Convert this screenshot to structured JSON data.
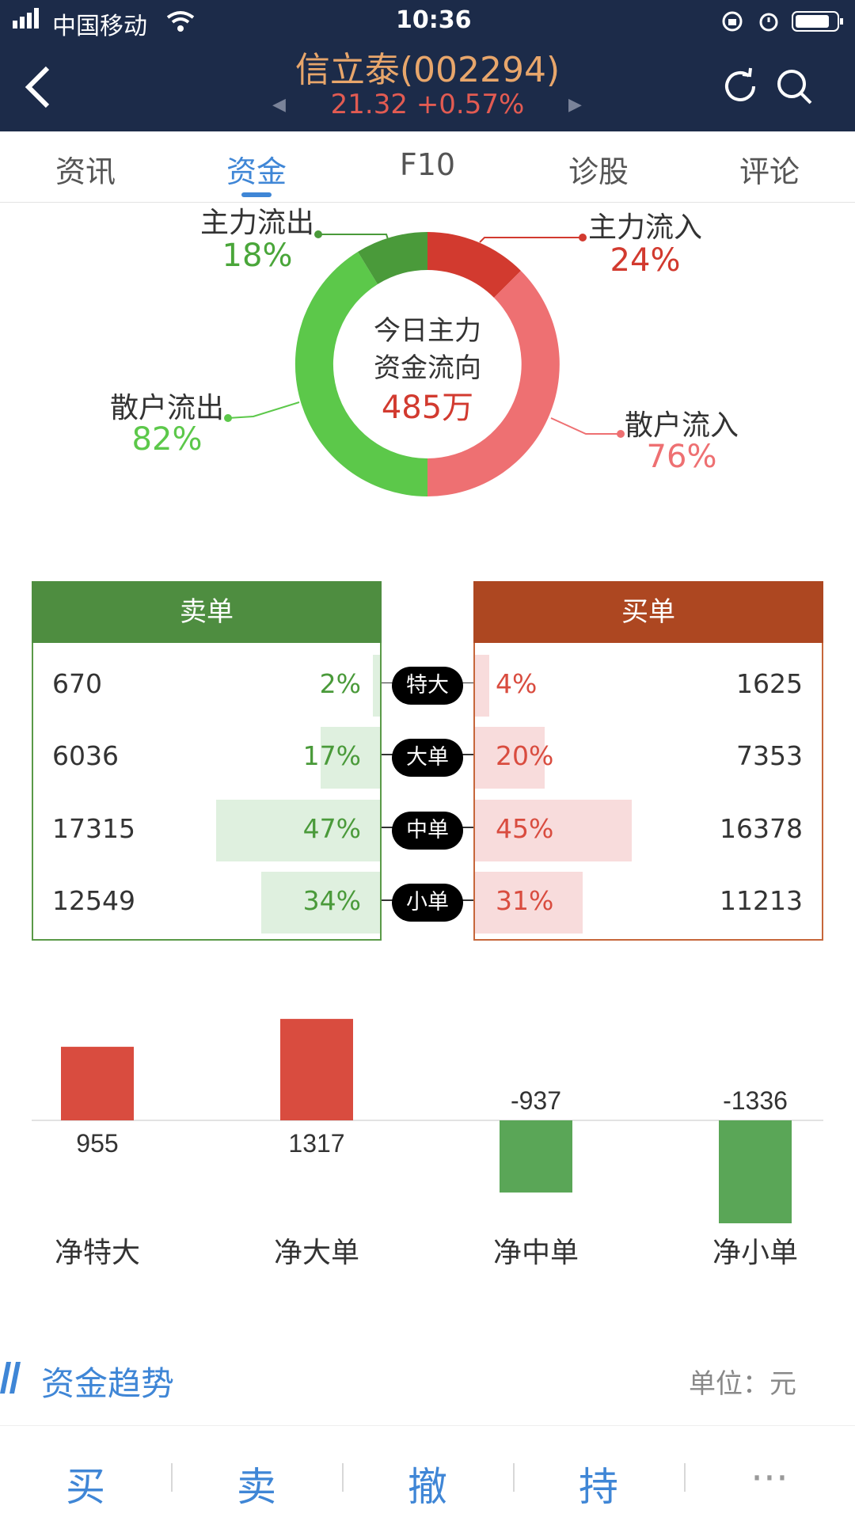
{
  "status_bar": {
    "carrier": "中国移动",
    "time": "10:36"
  },
  "header": {
    "title": "信立泰(002294)",
    "price": "21.32 +0.57%"
  },
  "tabs": [
    {
      "label": "资讯"
    },
    {
      "label": "资金",
      "active": true
    },
    {
      "label": "F10"
    },
    {
      "label": "诊股"
    },
    {
      "label": "评论"
    }
  ],
  "donut": {
    "center_line1": "今日主力",
    "center_line2": "资金流向",
    "center_value": "485万",
    "main_out": {
      "label": "主力流出",
      "pct": "18%"
    },
    "main_in": {
      "label": "主力流入",
      "pct": "24%"
    },
    "retail_out": {
      "label": "散户流出",
      "pct": "82%"
    },
    "retail_in": {
      "label": "散户流入",
      "pct": "76%"
    },
    "colors": {
      "main_in": "#d23a2f",
      "retail_in": "#ee7072",
      "main_out": "#4a9a3a",
      "retail_out": "#5cc84a"
    }
  },
  "orders": {
    "sell_header": "卖单",
    "buy_header": "买单",
    "rows": [
      {
        "type": "特大",
        "sell": "670",
        "sell_pct": "2%",
        "sell_frac": 0.02,
        "buy_pct": "4%",
        "buy_frac": 0.04,
        "buy": "1625"
      },
      {
        "type": "大单",
        "sell": "6036",
        "sell_pct": "17%",
        "sell_frac": 0.17,
        "buy_pct": "20%",
        "buy_frac": 0.2,
        "buy": "7353"
      },
      {
        "type": "中单",
        "sell": "17315",
        "sell_pct": "47%",
        "sell_frac": 0.47,
        "buy_pct": "45%",
        "buy_frac": 0.45,
        "buy": "16378"
      },
      {
        "type": "小单",
        "sell": "12549",
        "sell_pct": "34%",
        "sell_frac": 0.34,
        "buy_pct": "31%",
        "buy_frac": 0.31,
        "buy": "11213"
      }
    ]
  },
  "chart_data": {
    "type": "bar",
    "categories": [
      "净特大",
      "净大单",
      "净中单",
      "净小单"
    ],
    "values": [
      955,
      1317,
      -937,
      -1336
    ],
    "colors": {
      "positive": "#d94c3f",
      "negative": "#5aa657"
    }
  },
  "trend": {
    "title": "资金趋势",
    "unit": "单位：元"
  },
  "bottom_bar": {
    "buy": "买",
    "sell": "卖",
    "cancel": "撤",
    "hold": "持",
    "more": "···"
  }
}
